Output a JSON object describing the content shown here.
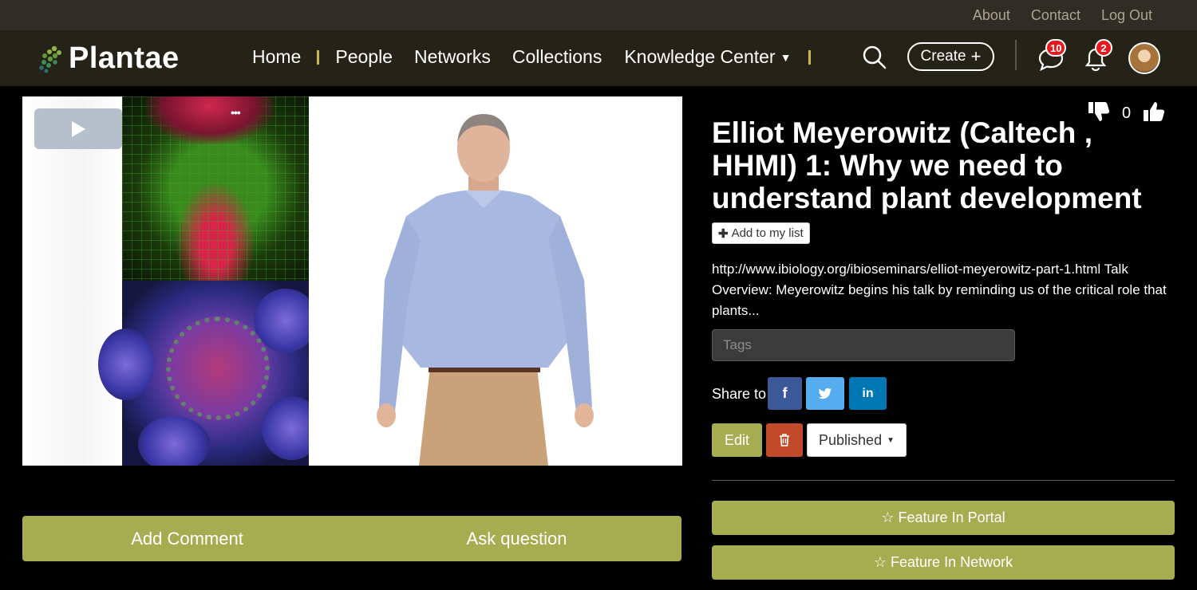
{
  "topbar": {
    "links": [
      "About",
      "Contact",
      "Log Out"
    ]
  },
  "nav": {
    "logo": "Plantae",
    "items": [
      "Home",
      "People",
      "Networks",
      "Collections",
      "Knowledge Center"
    ],
    "create_label": "Create",
    "messages_badge": "10",
    "notifications_badge": "2"
  },
  "video": {
    "dots": "•••"
  },
  "actions": {
    "comment": "Add Comment",
    "question": "Ask question"
  },
  "post": {
    "vote_count": "0",
    "title": "Elliot Meyerowitz (Caltech , HHMI) 1: Why we need to understand plant development",
    "add_to_list": "Add to my list",
    "description": "http://www.ibiology.org/ibioseminars/elliot-meyerowitz-part-1.html Talk Overview: Meyerowitz begins his talk by reminding us of the critical role that plants...",
    "tags_placeholder": "Tags",
    "share_label": "Share to",
    "share": [
      {
        "name": "facebook",
        "glyph": "f",
        "color": "#3b5998"
      },
      {
        "name": "twitter",
        "glyph": "t",
        "color": "#55acee"
      },
      {
        "name": "linkedin",
        "glyph": "in",
        "color": "#0077b5"
      }
    ],
    "edit_label": "Edit",
    "status_label": "Published",
    "feature_portal": "Feature In Portal",
    "feature_network": "Feature In Network"
  },
  "colors": {
    "accent": "#a6ad51",
    "delete": "#c14a2a",
    "badge": "#e6191e"
  }
}
